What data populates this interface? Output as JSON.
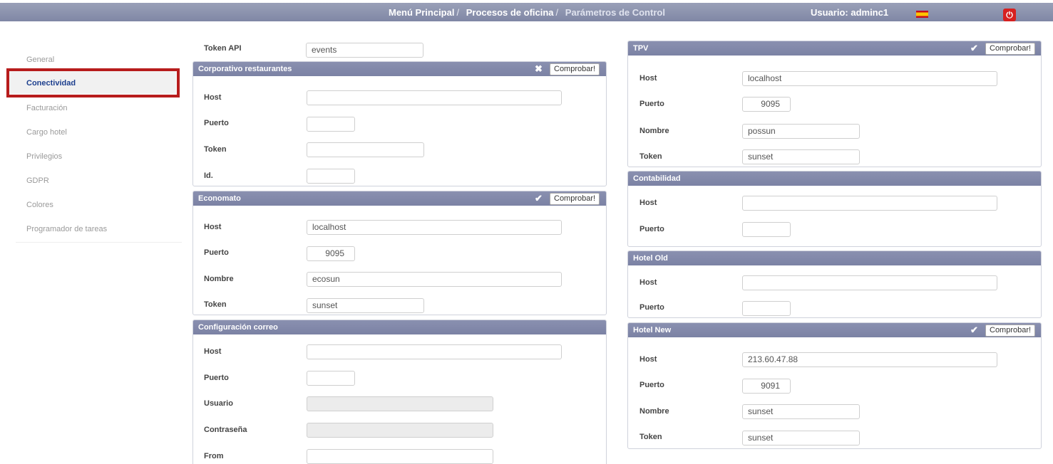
{
  "header": {
    "breadcrumb": [
      {
        "label": "Menú Principal"
      },
      {
        "label": "Procesos de oficina"
      },
      {
        "label": "Parámetros de Control"
      }
    ],
    "separator": "/",
    "user": "Usuario: adminc1",
    "flag_icon": "spain-flag-icon",
    "power_icon": "power-icon",
    "power_glyph": "⏻"
  },
  "sidebar": {
    "items": [
      {
        "label": "General"
      },
      {
        "label": "Conectividad",
        "active": true
      },
      {
        "label": "Facturación"
      },
      {
        "label": "Cargo hotel"
      },
      {
        "label": "Privilegios"
      },
      {
        "label": "GDPR"
      },
      {
        "label": "Colores"
      },
      {
        "label": "Programador de tareas"
      }
    ],
    "highlight_color": "#b71c1c"
  },
  "common": {
    "check_label": "Comprobar!",
    "ok_glyph": "✔",
    "fail_glyph": "✖",
    "host": "Host",
    "port": "Puerto",
    "name": "Nombre",
    "token": "Token",
    "id": "Id.",
    "user": "Usuario",
    "password": "Contraseña",
    "from": "From"
  },
  "left": {
    "token_api": {
      "label": "Token API",
      "value": "events"
    },
    "corporativo": {
      "title": "Corporativo restaurantes",
      "status": "fail",
      "host": "",
      "port": "",
      "token": "",
      "id": ""
    },
    "economato": {
      "title": "Economato",
      "status": "ok",
      "host": "localhost",
      "port": "9095",
      "name": "ecosun",
      "token": "sunset"
    },
    "correo": {
      "title": "Configuración correo",
      "host": "",
      "port": "",
      "user": "",
      "password": "",
      "from": ""
    }
  },
  "right": {
    "tpv": {
      "title": "TPV",
      "status": "ok",
      "host": "localhost",
      "port": "9095",
      "name": "possun",
      "token": "sunset"
    },
    "contabilidad": {
      "title": "Contabilidad",
      "host": "",
      "port": ""
    },
    "hotel_old": {
      "title": "Hotel Old",
      "host": "",
      "port": ""
    },
    "hotel_new": {
      "title": "Hotel New",
      "status": "ok",
      "host": "213.60.47.88",
      "port": "9091",
      "name": "sunset",
      "token": "sunset"
    }
  },
  "colors": {
    "panel_header": "#7b82a4",
    "top_bar": "#8a90ad",
    "active_link": "#1d3f8e"
  }
}
